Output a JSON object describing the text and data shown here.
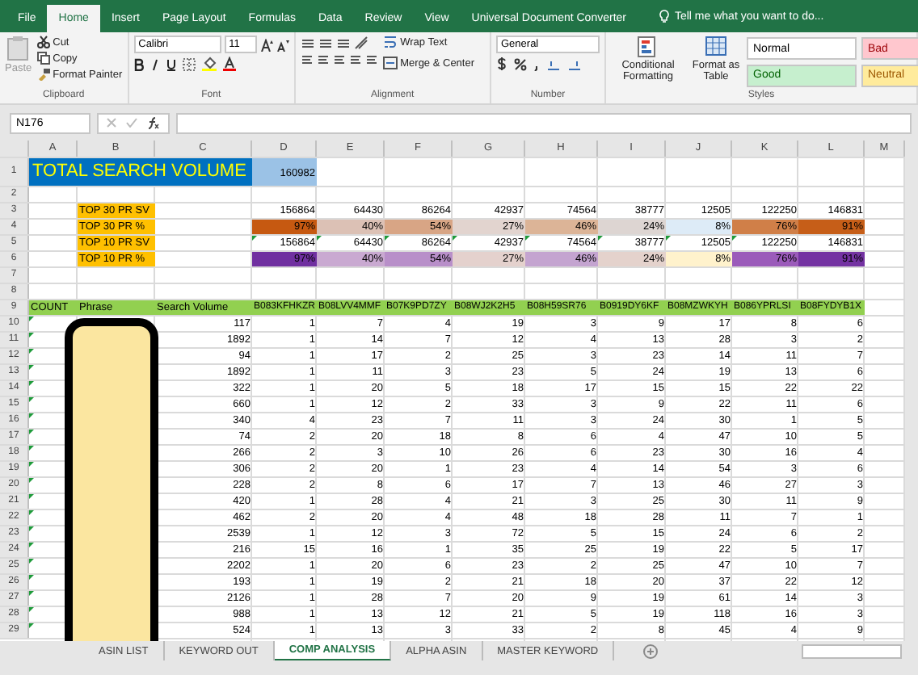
{
  "ribbon_tabs": [
    {
      "label": "File",
      "selected": false
    },
    {
      "label": "Home",
      "selected": true
    },
    {
      "label": "Insert",
      "selected": false
    },
    {
      "label": "Page Layout",
      "selected": false
    },
    {
      "label": "Formulas",
      "selected": false
    },
    {
      "label": "Data",
      "selected": false
    },
    {
      "label": "Review",
      "selected": false
    },
    {
      "label": "View",
      "selected": false
    },
    {
      "label": "Universal Document Converter",
      "selected": false
    }
  ],
  "tell_me": "Tell me what you want to do...",
  "clipboard": {
    "paste": "Paste",
    "cut": "Cut",
    "copy": "Copy",
    "format_painter": "Format Painter",
    "group": "Clipboard"
  },
  "font": {
    "name": "Calibri",
    "size": "11",
    "group": "Font"
  },
  "alignment": {
    "wrap": "Wrap Text",
    "merge": "Merge & Center",
    "group": "Alignment"
  },
  "number": {
    "format": "General",
    "group": "Number"
  },
  "styles": {
    "conditional": "Conditional Formatting",
    "format_table": "Format as Table",
    "group": "Styles",
    "cells": [
      {
        "label": "Normal",
        "color": "#ffffff"
      },
      {
        "label": "Bad",
        "color": "#ffc7ce"
      },
      {
        "label": "Good",
        "color": "#c6efce"
      },
      {
        "label": "Neutral",
        "color": "#ffeb9c"
      }
    ]
  },
  "name_box": "N176",
  "columns": [
    "A",
    "B",
    "C",
    "D",
    "E",
    "F",
    "G",
    "H",
    "I",
    "J",
    "K",
    "L",
    "M"
  ],
  "rows": [
    {
      "number": "1",
      "kind": "title",
      "title": "TOTAL SEARCH VOLUME",
      "total": "160982"
    },
    {
      "number": "2",
      "kind": "empty"
    },
    {
      "number": "3",
      "kind": "metric",
      "label": "TOP 30 PR SV",
      "values": [
        {
          "text": "156864"
        },
        {
          "text": "64430"
        },
        {
          "text": "86264"
        },
        {
          "text": "42937"
        },
        {
          "text": "74564"
        },
        {
          "text": "38777"
        },
        {
          "text": "12505"
        },
        {
          "text": "122250"
        },
        {
          "text": "146831"
        }
      ]
    },
    {
      "number": "4",
      "kind": "metric",
      "label": "TOP 30 PR %",
      "values": [
        {
          "text": "97%",
          "color": "#c65911"
        },
        {
          "text": "40%",
          "color": "#dcc1b5"
        },
        {
          "text": "54%",
          "color": "#d8a585"
        },
        {
          "text": "27%",
          "color": "#e2d4cf"
        },
        {
          "text": "46%",
          "color": "#dcb497"
        },
        {
          "text": "24%",
          "color": "#ddd5d2"
        },
        {
          "text": "8%",
          "color": "#ddebf7"
        },
        {
          "text": "76%",
          "color": "#d07f48"
        },
        {
          "text": "91%",
          "color": "#c65e18"
        }
      ]
    },
    {
      "number": "5",
      "kind": "metric",
      "label": "TOP 10 PR SV",
      "values": [
        {
          "text": "156864"
        },
        {
          "text": "64430"
        },
        {
          "text": "86264"
        },
        {
          "text": "42937"
        },
        {
          "text": "74564"
        },
        {
          "text": "38777"
        },
        {
          "text": "12505"
        },
        {
          "text": "122250"
        },
        {
          "text": "146831"
        }
      ]
    },
    {
      "number": "6",
      "kind": "metric",
      "label": "TOP 10 PR %",
      "values": [
        {
          "text": "97%",
          "color": "#7030a0"
        },
        {
          "text": "40%",
          "color": "#c9a9d1"
        },
        {
          "text": "54%",
          "color": "#b88fc9"
        },
        {
          "text": "27%",
          "color": "#e4d1cd"
        },
        {
          "text": "46%",
          "color": "#c4a4d0"
        },
        {
          "text": "24%",
          "color": "#e4d2cc"
        },
        {
          "text": "8%",
          "color": "#fff2cc"
        },
        {
          "text": "76%",
          "color": "#9b5bba"
        },
        {
          "text": "91%",
          "color": "#7433a2"
        }
      ]
    },
    {
      "number": "7",
      "kind": "empty"
    },
    {
      "number": "8",
      "kind": "empty"
    },
    {
      "number": "9",
      "kind": "header",
      "cells": [
        "COUNT",
        "Phrase",
        "Search Volume",
        "B083KFHKZR",
        "B08LVV4MMF",
        "B07K9PD7ZY",
        "B08WJ2K2H5",
        "B08H59SR76",
        "B0919DY6KF",
        "B08MZWKYH",
        "B086YPRLSI",
        "B08FYDYB1X"
      ]
    },
    {
      "number": "10",
      "kind": "data",
      "cells": [
        "117",
        "1",
        "7",
        "4",
        "19",
        "3",
        "9",
        "17",
        "8",
        "6"
      ]
    },
    {
      "number": "11",
      "kind": "data",
      "cells": [
        "1892",
        "1",
        "14",
        "7",
        "12",
        "4",
        "13",
        "28",
        "3",
        "2"
      ]
    },
    {
      "number": "12",
      "kind": "data",
      "cells": [
        "94",
        "1",
        "17",
        "2",
        "25",
        "3",
        "23",
        "14",
        "11",
        "7"
      ]
    },
    {
      "number": "13",
      "kind": "data",
      "cells": [
        "1892",
        "1",
        "11",
        "3",
        "23",
        "5",
        "24",
        "19",
        "13",
        "6"
      ]
    },
    {
      "number": "14",
      "kind": "data",
      "cells": [
        "322",
        "1",
        "20",
        "5",
        "18",
        "17",
        "15",
        "15",
        "22",
        "22"
      ]
    },
    {
      "number": "15",
      "kind": "data",
      "cells": [
        "660",
        "1",
        "12",
        "2",
        "33",
        "3",
        "9",
        "22",
        "11",
        "6"
      ]
    },
    {
      "number": "16",
      "kind": "data",
      "cells": [
        "340",
        "4",
        "23",
        "7",
        "11",
        "3",
        "24",
        "30",
        "1",
        "5"
      ]
    },
    {
      "number": "17",
      "kind": "data",
      "cells": [
        "74",
        "2",
        "20",
        "18",
        "8",
        "6",
        "4",
        "47",
        "10",
        "5"
      ]
    },
    {
      "number": "18",
      "kind": "data",
      "cells": [
        "266",
        "2",
        "3",
        "10",
        "26",
        "6",
        "23",
        "30",
        "16",
        "4"
      ]
    },
    {
      "number": "19",
      "kind": "data",
      "cells": [
        "306",
        "2",
        "20",
        "1",
        "23",
        "4",
        "14",
        "54",
        "3",
        "6"
      ]
    },
    {
      "number": "20",
      "kind": "data",
      "cells": [
        "228",
        "2",
        "8",
        "6",
        "17",
        "7",
        "13",
        "46",
        "27",
        "3"
      ]
    },
    {
      "number": "21",
      "kind": "data",
      "cells": [
        "420",
        "1",
        "28",
        "4",
        "21",
        "3",
        "25",
        "30",
        "11",
        "9"
      ]
    },
    {
      "number": "22",
      "kind": "data",
      "cells": [
        "462",
        "2",
        "20",
        "4",
        "48",
        "18",
        "28",
        "11",
        "7",
        "1"
      ]
    },
    {
      "number": "23",
      "kind": "data",
      "cells": [
        "2539",
        "1",
        "12",
        "3",
        "72",
        "5",
        "15",
        "24",
        "6",
        "2"
      ]
    },
    {
      "number": "24",
      "kind": "data",
      "cells": [
        "216",
        "15",
        "16",
        "1",
        "35",
        "25",
        "19",
        "22",
        "5",
        "17"
      ]
    },
    {
      "number": "25",
      "kind": "data",
      "cells": [
        "2202",
        "1",
        "20",
        "6",
        "23",
        "2",
        "25",
        "47",
        "10",
        "7"
      ]
    },
    {
      "number": "26",
      "kind": "data",
      "cells": [
        "193",
        "1",
        "19",
        "2",
        "21",
        "18",
        "20",
        "37",
        "22",
        "12"
      ]
    },
    {
      "number": "27",
      "kind": "data",
      "cells": [
        "2126",
        "1",
        "28",
        "7",
        "20",
        "9",
        "19",
        "61",
        "14",
        "3"
      ]
    },
    {
      "number": "28",
      "kind": "data",
      "cells": [
        "988",
        "1",
        "13",
        "12",
        "21",
        "5",
        "19",
        "118",
        "16",
        "3"
      ]
    },
    {
      "number": "29",
      "kind": "data",
      "cells": [
        "524",
        "1",
        "13",
        "3",
        "33",
        "2",
        "8",
        "45",
        "4",
        "9"
      ]
    }
  ],
  "sheet_tabs": [
    {
      "label": "ASIN LIST",
      "selected": false
    },
    {
      "label": "KEYWORD OUT",
      "selected": false
    },
    {
      "label": "COMP ANALYSIS",
      "selected": true
    },
    {
      "label": "ALPHA ASIN",
      "selected": false
    },
    {
      "label": "MASTER KEYWORD",
      "selected": false
    }
  ]
}
